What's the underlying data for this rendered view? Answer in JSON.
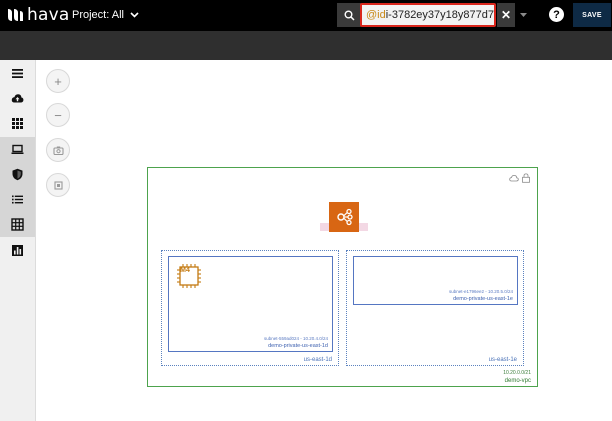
{
  "header": {
    "logo_text": "hava",
    "project_label": "Project: All",
    "search": {
      "prefix": "@id",
      "value": "i-3782ey37y18y877d7"
    },
    "clear_label": "✕",
    "help_label": "?",
    "save_label": "SAVE"
  },
  "sidebar": {
    "items": [
      {
        "icon": "menu-icon",
        "active": false
      },
      {
        "icon": "cloud-upload-icon",
        "active": false
      },
      {
        "icon": "apps-grid-icon",
        "active": false
      },
      {
        "icon": "laptop-icon",
        "active": true
      },
      {
        "icon": "shield-icon",
        "active": true
      },
      {
        "icon": "list-icon",
        "active": true
      },
      {
        "icon": "table-icon",
        "active": true
      },
      {
        "icon": "report-icon",
        "active": false
      }
    ]
  },
  "tools": [
    {
      "icon": "zoom-in-icon",
      "label": "+"
    },
    {
      "icon": "zoom-out-icon",
      "label": "−"
    },
    {
      "icon": "camera-icon"
    },
    {
      "icon": "stop-icon"
    }
  ],
  "diagram": {
    "vpc": {
      "cidr": "10.20.0.0/21",
      "name": "demo-vpc"
    },
    "availability_zones": [
      {
        "name": "us-east-1d",
        "subnet": {
          "cidr": "subnet-559ad024 - 10.20.4.0/24",
          "name": "demo-private-us-east-1d",
          "instance_label": "M4"
        }
      },
      {
        "name": "us-east-1e",
        "subnet": {
          "cidr": "subnet-e1796ee2 - 10.20.5.0/24",
          "name": "demo-private-us-east-1e"
        }
      }
    ]
  },
  "colors": {
    "topbar": "#000000",
    "subbar": "#2f2f2f",
    "save_button": "#0e2a45",
    "search_highlight": "#d9261c",
    "vpc_border": "#4da34d",
    "subnet_border": "#5576c2",
    "igw": "#d86613",
    "ec2": "#c47a12"
  }
}
